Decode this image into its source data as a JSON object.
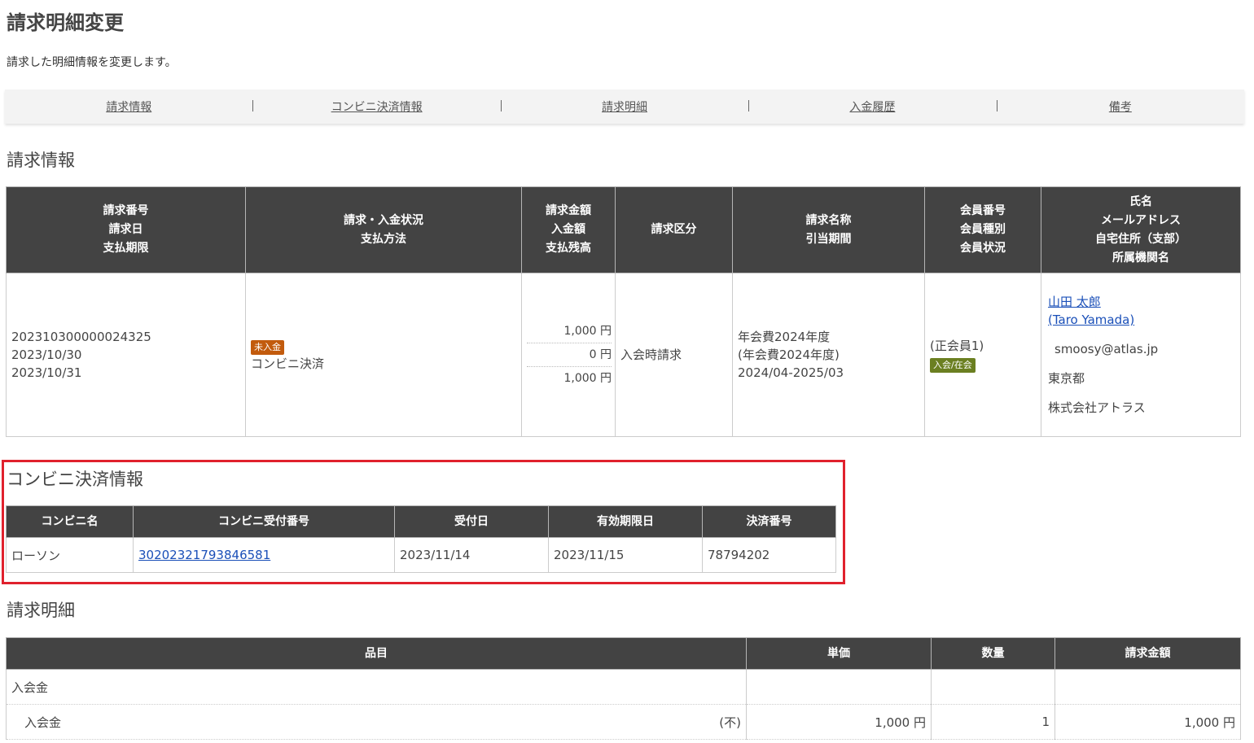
{
  "page": {
    "title": "請求明細変更",
    "description": "請求した明細情報を変更します。"
  },
  "tabs": [
    "請求情報",
    "コンビニ決済情報",
    "請求明細",
    "入金履歴",
    "備考"
  ],
  "billing_info": {
    "section_title": "請求情報",
    "headers": [
      [
        "請求番号",
        "請求日",
        "支払期限"
      ],
      [
        "請求・入金状況",
        "支払方法"
      ],
      [
        "請求金額",
        "入金額",
        "支払残高"
      ],
      [
        "請求区分"
      ],
      [
        "請求名称",
        "引当期間"
      ],
      [
        "会員番号",
        "会員種別",
        "会員状況"
      ],
      [
        "氏名",
        "メールアドレス",
        "自宅住所（支部）",
        "所属機関名"
      ]
    ],
    "row": {
      "invoice_number": "202310300000024325",
      "invoice_date": "2023/10/30",
      "due_date": "2023/10/31",
      "status_badge": "未入金",
      "payment_method": "コンビニ決済",
      "amount_billed": "1,000 円",
      "amount_paid": "0 円",
      "balance": "1,000 円",
      "billing_type": "入会時請求",
      "billing_name": "年会費2024年度",
      "billing_name_sub": "(年会費2024年度)",
      "period": "2024/04-2025/03",
      "member_type": "(正会員1)",
      "member_status_badge": "入会/在会",
      "name": "山田 太郎",
      "name_en": "(Taro Yamada)",
      "email": "smoosy@atlas.jp",
      "address": "東京都",
      "organization": "株式会社アトラス"
    }
  },
  "konbini": {
    "section_title": "コンビニ決済情報",
    "headers": [
      "コンビニ名",
      "コンビニ受付番号",
      "受付日",
      "有効期限日",
      "決済番号"
    ],
    "row": {
      "store": "ローソン",
      "receipt_number": "30202321793846581",
      "receipt_date": "2023/11/14",
      "expiry_date": "2023/11/15",
      "payment_number": "78794202"
    }
  },
  "detail": {
    "section_title": "請求明細",
    "headers": [
      "品目",
      "単価",
      "数量",
      "請求金額"
    ],
    "rows": [
      {
        "item": "入会金",
        "tax": "",
        "unit_price": "",
        "qty": "",
        "amount": ""
      },
      {
        "item": "入会金",
        "tax": "(不)",
        "unit_price": "1,000 円",
        "qty": "1",
        "amount": "1,000 円"
      }
    ]
  },
  "colors": {
    "header_bg": "#434343",
    "highlight": "#e0212d",
    "badge_unpaid": "#c25b0d",
    "badge_member": "#6b7f21"
  }
}
